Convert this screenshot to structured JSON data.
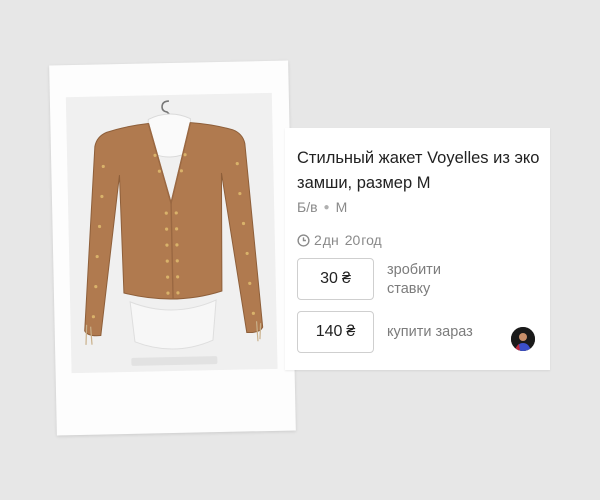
{
  "listing": {
    "title": "Стильный жакет Voyelles из эко замши, размер M",
    "condition": "Б/в",
    "size": "M",
    "time_left": {
      "days": "2",
      "days_unit": "дн",
      "hours": "20",
      "hours_unit": "год"
    },
    "bid": {
      "amount": "30",
      "currency": "₴",
      "label": "зробити ставку"
    },
    "buy_now": {
      "amount": "140",
      "currency": "₴",
      "label": "купити зараз"
    }
  },
  "icons": {
    "timer": "clock-icon",
    "seller": "avatar"
  },
  "colors": {
    "page_background": "#e7e7e7",
    "card_background": "#ffffff",
    "jacket": "#b07a4f",
    "muted_text": "#8a8a8a"
  }
}
